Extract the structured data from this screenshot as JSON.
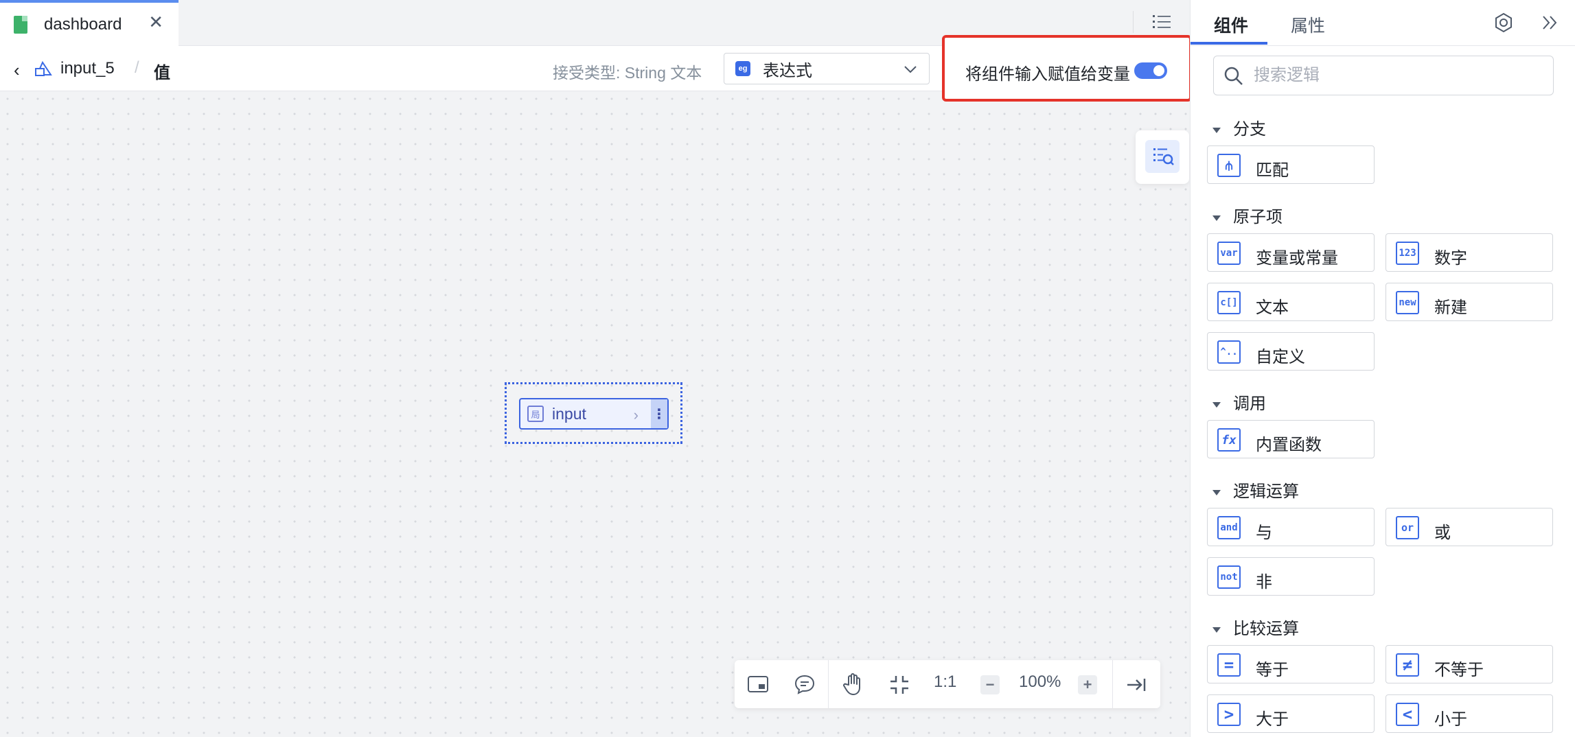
{
  "tabbar": {
    "tab_label": "dashboard",
    "close_glyph": "✕"
  },
  "toolbar": {
    "component_name": "input_5",
    "breadcrumb_sep": "/",
    "current": "值",
    "accept_type": "接受类型: String 文本",
    "expression_badge": "eg",
    "expression_value": "表达式",
    "assign_label": "将组件输入赋值给变量",
    "assign_enabled": true
  },
  "canvas": {
    "node": {
      "badge": "局",
      "label": "input"
    },
    "bottom_bar": {
      "ratio": "1:1",
      "zoom": "100%",
      "minus": "−",
      "plus": "+"
    }
  },
  "panel": {
    "tabs": [
      "组件",
      "属性"
    ],
    "search_placeholder": "搜索逻辑",
    "sections": [
      {
        "title": "分支",
        "items": [
          {
            "icon": "match-icon",
            "glyph": "⋔",
            "label": "匹配"
          }
        ]
      },
      {
        "title": "原子项",
        "items": [
          {
            "icon": "var-icon",
            "glyph": "var",
            "label": "变量或常量"
          },
          {
            "icon": "number-icon",
            "glyph": "123",
            "label": "数字"
          },
          {
            "icon": "text-icon",
            "glyph": "c[]",
            "label": "文本"
          },
          {
            "icon": "new-icon",
            "glyph": "new",
            "label": "新建"
          },
          {
            "icon": "custom-icon",
            "glyph": "^..",
            "label": "自定义"
          }
        ]
      },
      {
        "title": "调用",
        "items": [
          {
            "icon": "fx-icon",
            "glyph": "fx",
            "label": "内置函数"
          }
        ]
      },
      {
        "title": "逻辑运算",
        "items": [
          {
            "icon": "and-icon",
            "glyph": "and",
            "label": "与"
          },
          {
            "icon": "or-icon",
            "glyph": "or",
            "label": "或"
          },
          {
            "icon": "not-icon",
            "glyph": "not",
            "label": "非"
          }
        ]
      },
      {
        "title": "比较运算",
        "items": [
          {
            "icon": "equal-icon",
            "glyph": "=",
            "label": "等于"
          },
          {
            "icon": "not-equal-icon",
            "glyph": "≠",
            "label": "不等于"
          },
          {
            "icon": "greater-icon",
            "glyph": ">",
            "label": "大于"
          },
          {
            "icon": "less-icon",
            "glyph": "<",
            "label": "小于"
          }
        ]
      }
    ]
  },
  "colors": {
    "accent": "#3a6ae5",
    "highlight_border": "#e5332a",
    "toggle_on": "#4a78ee"
  }
}
